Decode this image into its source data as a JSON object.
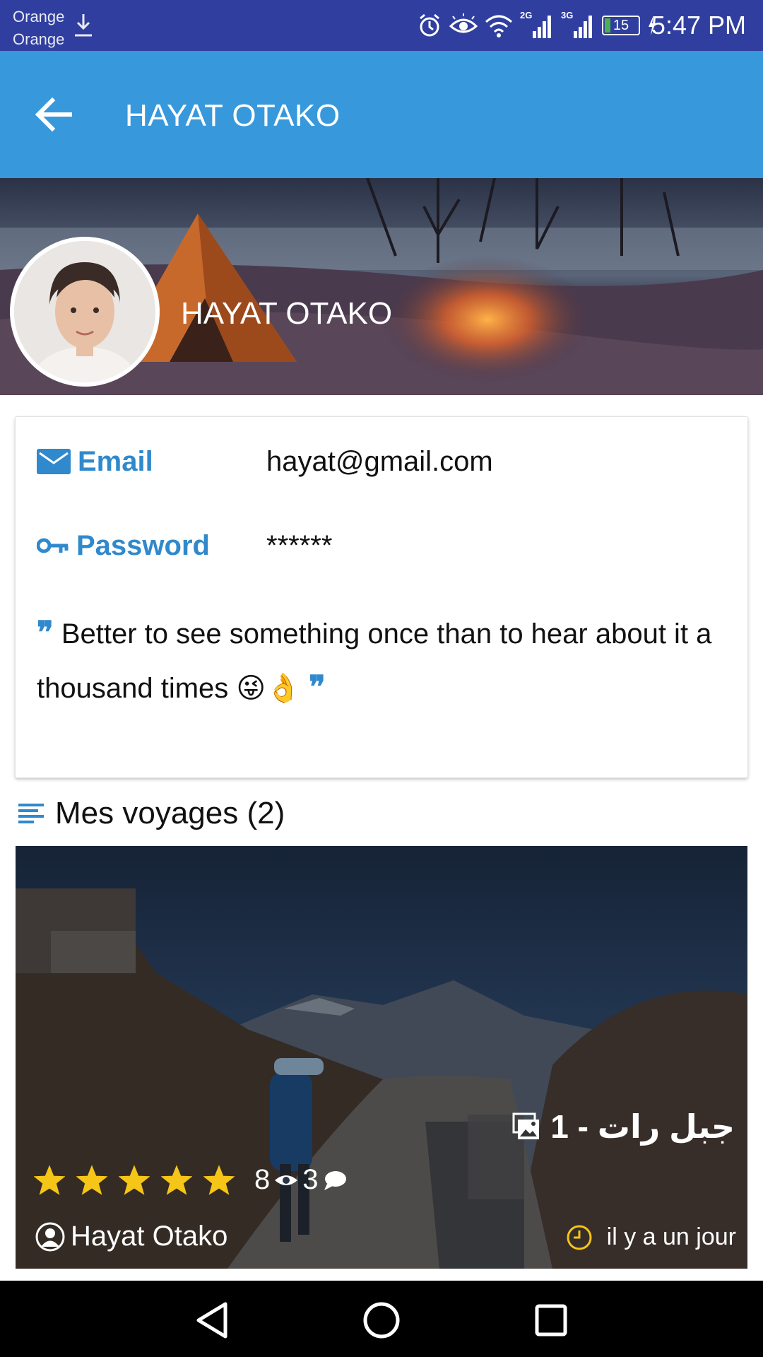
{
  "status_bar": {
    "carrier_1": "Orange",
    "carrier_2": "Orange",
    "battery_level": "15",
    "time": "5:47 PM",
    "network_1": "2G",
    "network_2": "3G",
    "icons": [
      "download-icon",
      "alarm-icon",
      "eye-icon",
      "wifi-icon",
      "signal-icon",
      "signal-icon",
      "battery-icon",
      "charging-icon"
    ]
  },
  "app_bar": {
    "title": "HAYAT OTAKO",
    "back_icon": "arrow-back-icon"
  },
  "profile": {
    "name": "HAYAT OTAKO"
  },
  "info": {
    "email_label": "Email",
    "email_value": "hayat@gmail.com",
    "password_label": "Password",
    "password_value": "******",
    "quote_text": "Better to see something once than to hear about it a thousand times",
    "quote_emoji": "😜👌"
  },
  "section": {
    "title": "Mes voyages (2)",
    "icon": "list-icon"
  },
  "trip": {
    "title": "جبل رات - 1",
    "rating": 5,
    "rating_max": 5,
    "views": "8",
    "comments": "3",
    "author": "Hayat Otako",
    "time": "il y a un jour"
  },
  "colors": {
    "status_bar": "#303f9f",
    "app_bar": "#3798dc",
    "accent": "#3089cc",
    "star": "#f5c518",
    "clock_icon": "#f5c518"
  }
}
